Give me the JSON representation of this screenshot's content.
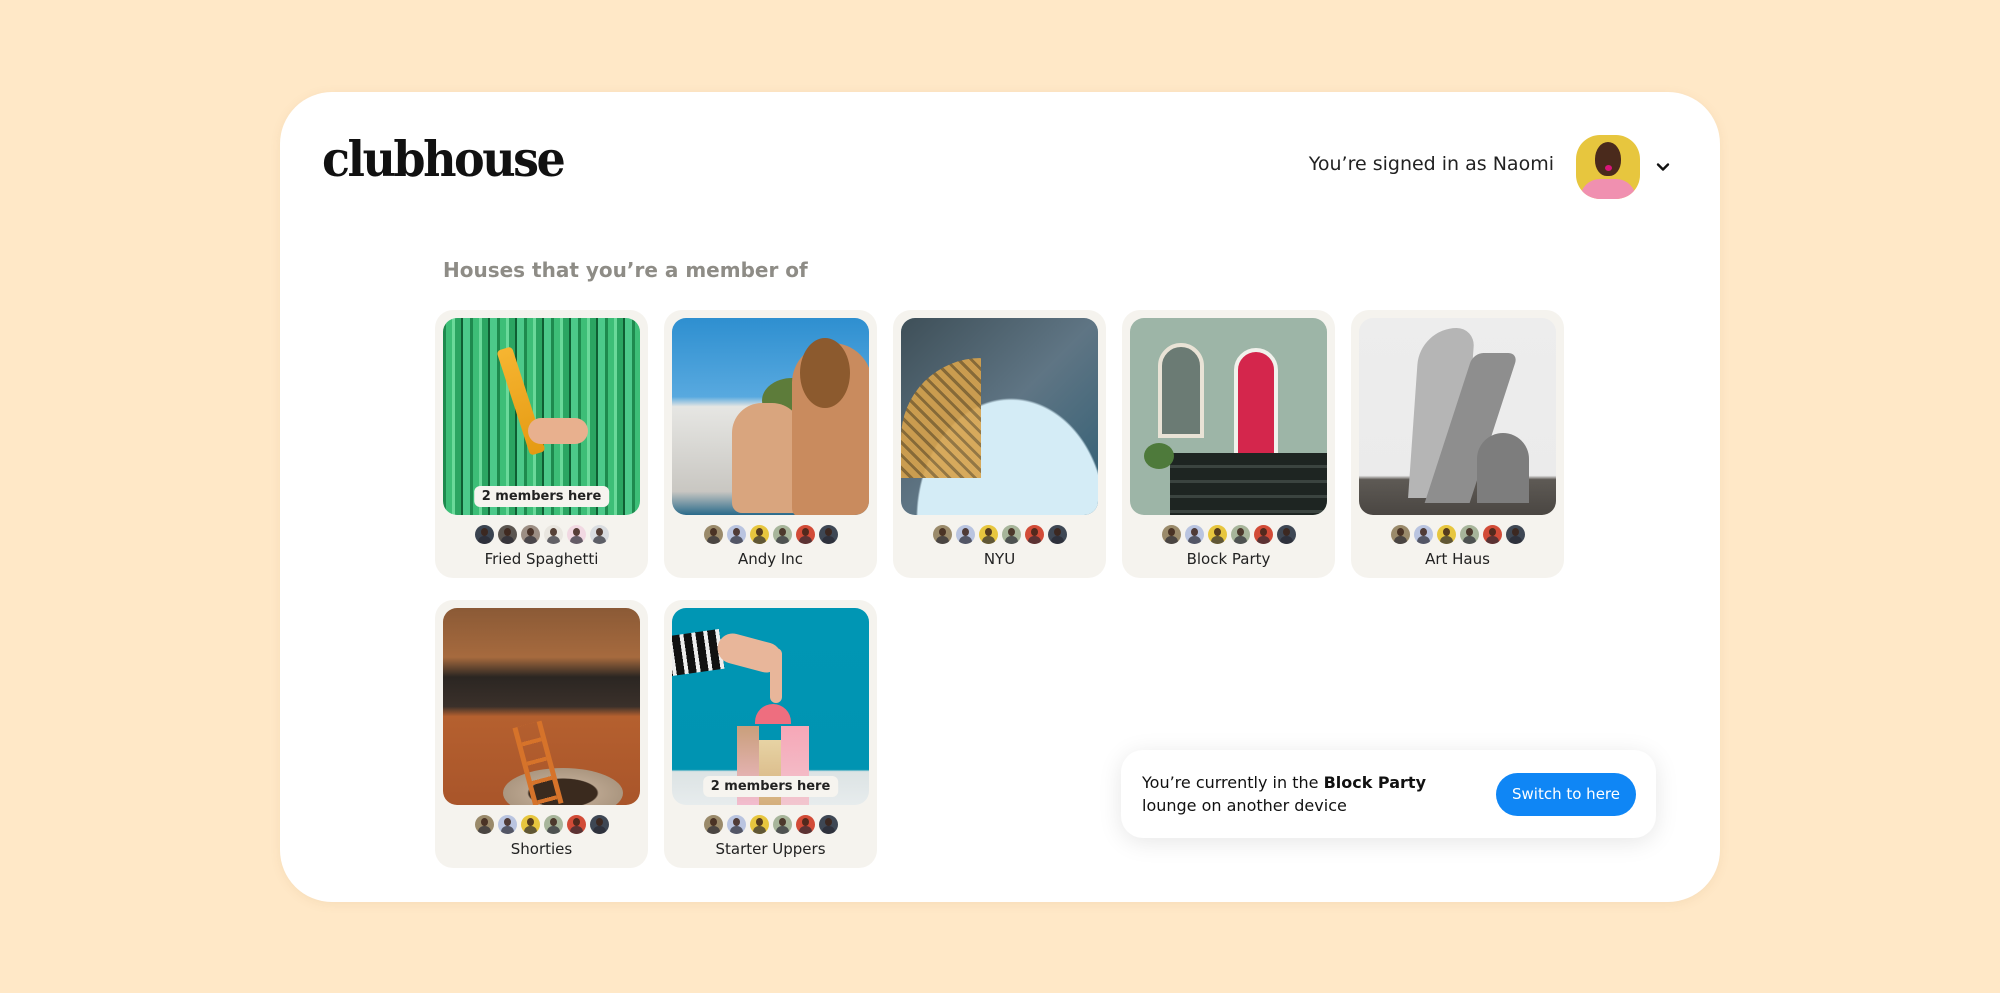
{
  "app": {
    "logo_text": "clubhouse"
  },
  "header": {
    "signed_in_text": "You’re signed in as Naomi",
    "user_name": "Naomi",
    "avatar_icon": "user-avatar",
    "menu_icon": "chevron-down-icon"
  },
  "main": {
    "section_title": "Houses that you’re a member of",
    "houses": [
      {
        "name": "Fried Spaghetti",
        "badge": "2 members here",
        "image": "green-curtain-spaghetti",
        "member_avatar_colors": [
          "#3A4350",
          "#5B5550",
          "#9C8E84",
          "#E9E6E0",
          "#F1D8E2",
          "#D9DCE0"
        ]
      },
      {
        "name": "Andy Inc",
        "badge": "",
        "image": "poolside-sunbathers",
        "member_avatar_colors": [
          "#9A8A6A",
          "#B9C4E0",
          "#E7C63E",
          "#A7B59A",
          "#D24B37",
          "#3E4754"
        ]
      },
      {
        "name": "NYU",
        "badge": "",
        "image": "washington-square-arch",
        "member_avatar_colors": [
          "#9A8A6A",
          "#B9C4E0",
          "#E7C63E",
          "#A7B59A",
          "#D24B37",
          "#3E4754"
        ]
      },
      {
        "name": "Block Party",
        "badge": "",
        "image": "brownstone-red-door",
        "member_avatar_colors": [
          "#9A8A6A",
          "#B9C4E0",
          "#E7C63E",
          "#A7B59A",
          "#D24B37",
          "#3E4754"
        ]
      },
      {
        "name": "Art Haus",
        "badge": "",
        "image": "grey-sculpture",
        "member_avatar_colors": [
          "#9A8A6A",
          "#B9C4E0",
          "#E7C63E",
          "#A7B59A",
          "#D24B37",
          "#3E4754"
        ]
      },
      {
        "name": "Shorties",
        "badge": "",
        "image": "ladder-in-hole",
        "member_avatar_colors": [
          "#9A8A6A",
          "#B9C4E0",
          "#E7C63E",
          "#A7B59A",
          "#D24B37",
          "#3E4754"
        ]
      },
      {
        "name": "Starter Uppers",
        "badge": "2 members here",
        "image": "toy-blocks",
        "member_avatar_colors": [
          "#9A8A6A",
          "#B9C4E0",
          "#E7C63E",
          "#A7B59A",
          "#D24B37",
          "#3E4754"
        ]
      }
    ]
  },
  "toast": {
    "text_before": "You’re currently in the ",
    "house_name": "Block Party",
    "text_after": " lounge on another device",
    "button_label": "Switch to here"
  },
  "colors": {
    "background": "#FFE8C7",
    "panel": "#FFFFFF",
    "card": "#F5F3EE",
    "accent_button": "#0F86F5",
    "section_title": "#8E8C86"
  }
}
